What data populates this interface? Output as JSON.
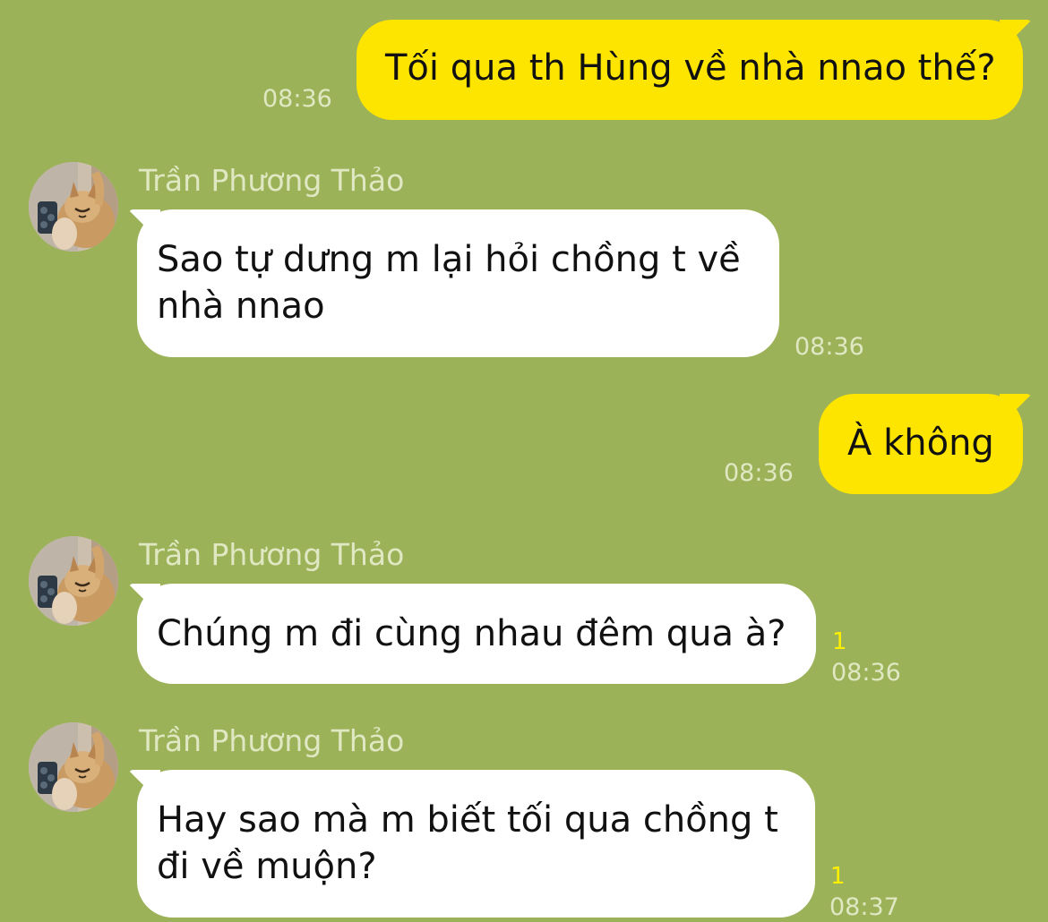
{
  "messages": [
    {
      "direction": "outgoing",
      "text": "Tối qua th Hùng về nhà nnao thế?",
      "time": "08:36"
    },
    {
      "direction": "incoming",
      "sender": "Trần Phương Thảo",
      "text": "Sao tự dưng m lại hỏi chồng t về nhà nnao",
      "time": "08:36",
      "avatar_icon": "cat-avatar-icon"
    },
    {
      "direction": "outgoing",
      "text": "À không",
      "time": "08:36"
    },
    {
      "direction": "incoming",
      "sender": "Trần Phương Thảo",
      "text": "Chúng m đi cùng nhau đêm qua à?",
      "time": "08:36",
      "unread": "1",
      "avatar_icon": "cat-avatar-icon"
    },
    {
      "direction": "incoming",
      "sender": "Trần Phương Thảo",
      "text": "Hay sao mà m biết tối qua chồng t đi về muộn?",
      "time": "08:37",
      "unread": "1",
      "avatar_icon": "cat-avatar-icon"
    }
  ],
  "colors": {
    "background": "#9cb258",
    "outgoing_bubble": "#fee500",
    "incoming_bubble": "#ffffff",
    "meta_text": "#dfe8c2",
    "unread_count": "#fff000"
  }
}
